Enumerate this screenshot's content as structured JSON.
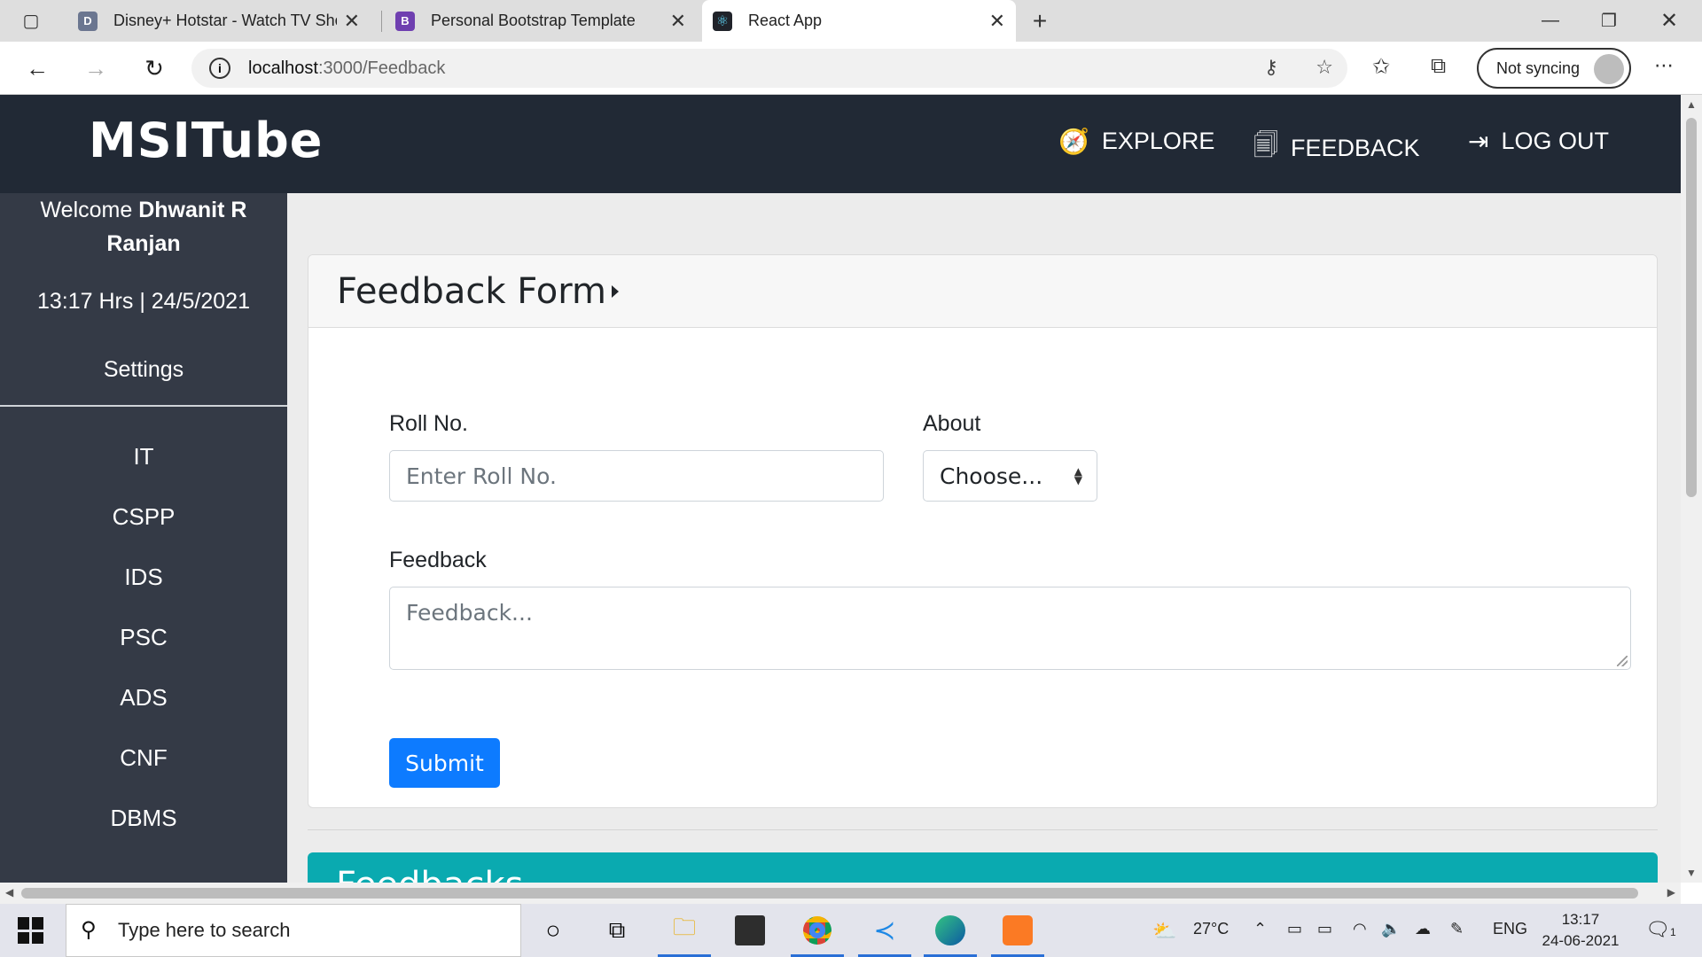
{
  "browser": {
    "tabs": [
      {
        "title": "Disney+ Hotstar - Watch TV Sho",
        "favicon": "hotstar-icon",
        "active": false
      },
      {
        "title": "Personal Bootstrap Template",
        "favicon": "bootstrap-icon",
        "active": false
      },
      {
        "title": "React App",
        "favicon": "react-icon",
        "active": true
      }
    ],
    "url_host": "localhost",
    "url_path": ":3000/Feedback",
    "sync_label": "Not syncing"
  },
  "app": {
    "brand": "MSITube",
    "nav": {
      "explore": "EXPLORE",
      "feedback": "FEEDBACK",
      "logout": "LOG OUT"
    },
    "sidebar": {
      "welcome_prefix": "Welcome",
      "user_name": "Dhwanit R Ranjan",
      "clock": "13:17 Hrs | 24/5/2021",
      "settings": "Settings",
      "items": [
        "IT",
        "CSPP",
        "IDS",
        "PSC",
        "ADS",
        "CNF",
        "DBMS"
      ]
    },
    "form": {
      "title": "Feedback Form",
      "roll_label": "Roll No.",
      "roll_placeholder": "Enter Roll No.",
      "about_label": "About",
      "about_selected": "Choose...",
      "feedback_label": "Feedback",
      "feedback_placeholder": "Feedback...",
      "submit": "Submit"
    },
    "feedbacks_title": "Feedbacks",
    "colors": {
      "navbar": "#212935",
      "sidebar": "#343a46",
      "primary": "#0d7bff",
      "teal": "#0aaab0"
    }
  },
  "taskbar": {
    "search_placeholder": "Type here to search",
    "weather": "27°C",
    "lang": "ENG",
    "time": "13:17",
    "date": "24-06-2021",
    "notifications": "1"
  }
}
